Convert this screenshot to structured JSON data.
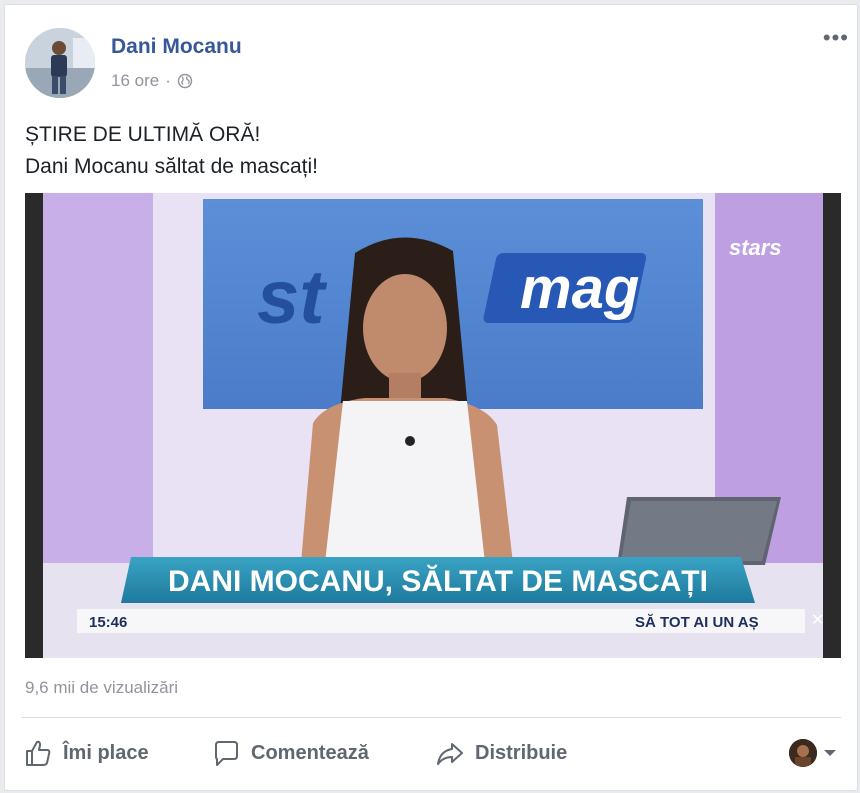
{
  "post": {
    "author": "Dani Mocanu",
    "time": "16 ore",
    "separator": "·",
    "text_line1": "ȘTIRE DE ULTIMĂ ORĂ!",
    "text_line2": "Dani Mocanu săltat de mascați!",
    "views": "9,6 mii de vizualizări"
  },
  "video": {
    "banner_headline": "DANI MOCANU, SĂLTAT DE MASCAȚI",
    "ticker_time": "15:46",
    "ticker_text": "SĂ TOT AI UN AȘ",
    "backdrop_logo_left": "st",
    "backdrop_logo_right": "mag",
    "channel_logo": "stars",
    "close_glyph": "✕"
  },
  "actions": {
    "like": "Îmi place",
    "comment": "Comentează",
    "share": "Distribuie"
  },
  "colors": {
    "link": "#365899",
    "muted": "#90949c",
    "action": "#606770",
    "banner": "#2b8cad"
  },
  "icons": [
    "globe-icon",
    "more-options-icon",
    "like-icon",
    "comment-icon",
    "share-icon",
    "chevron-down-icon"
  ]
}
